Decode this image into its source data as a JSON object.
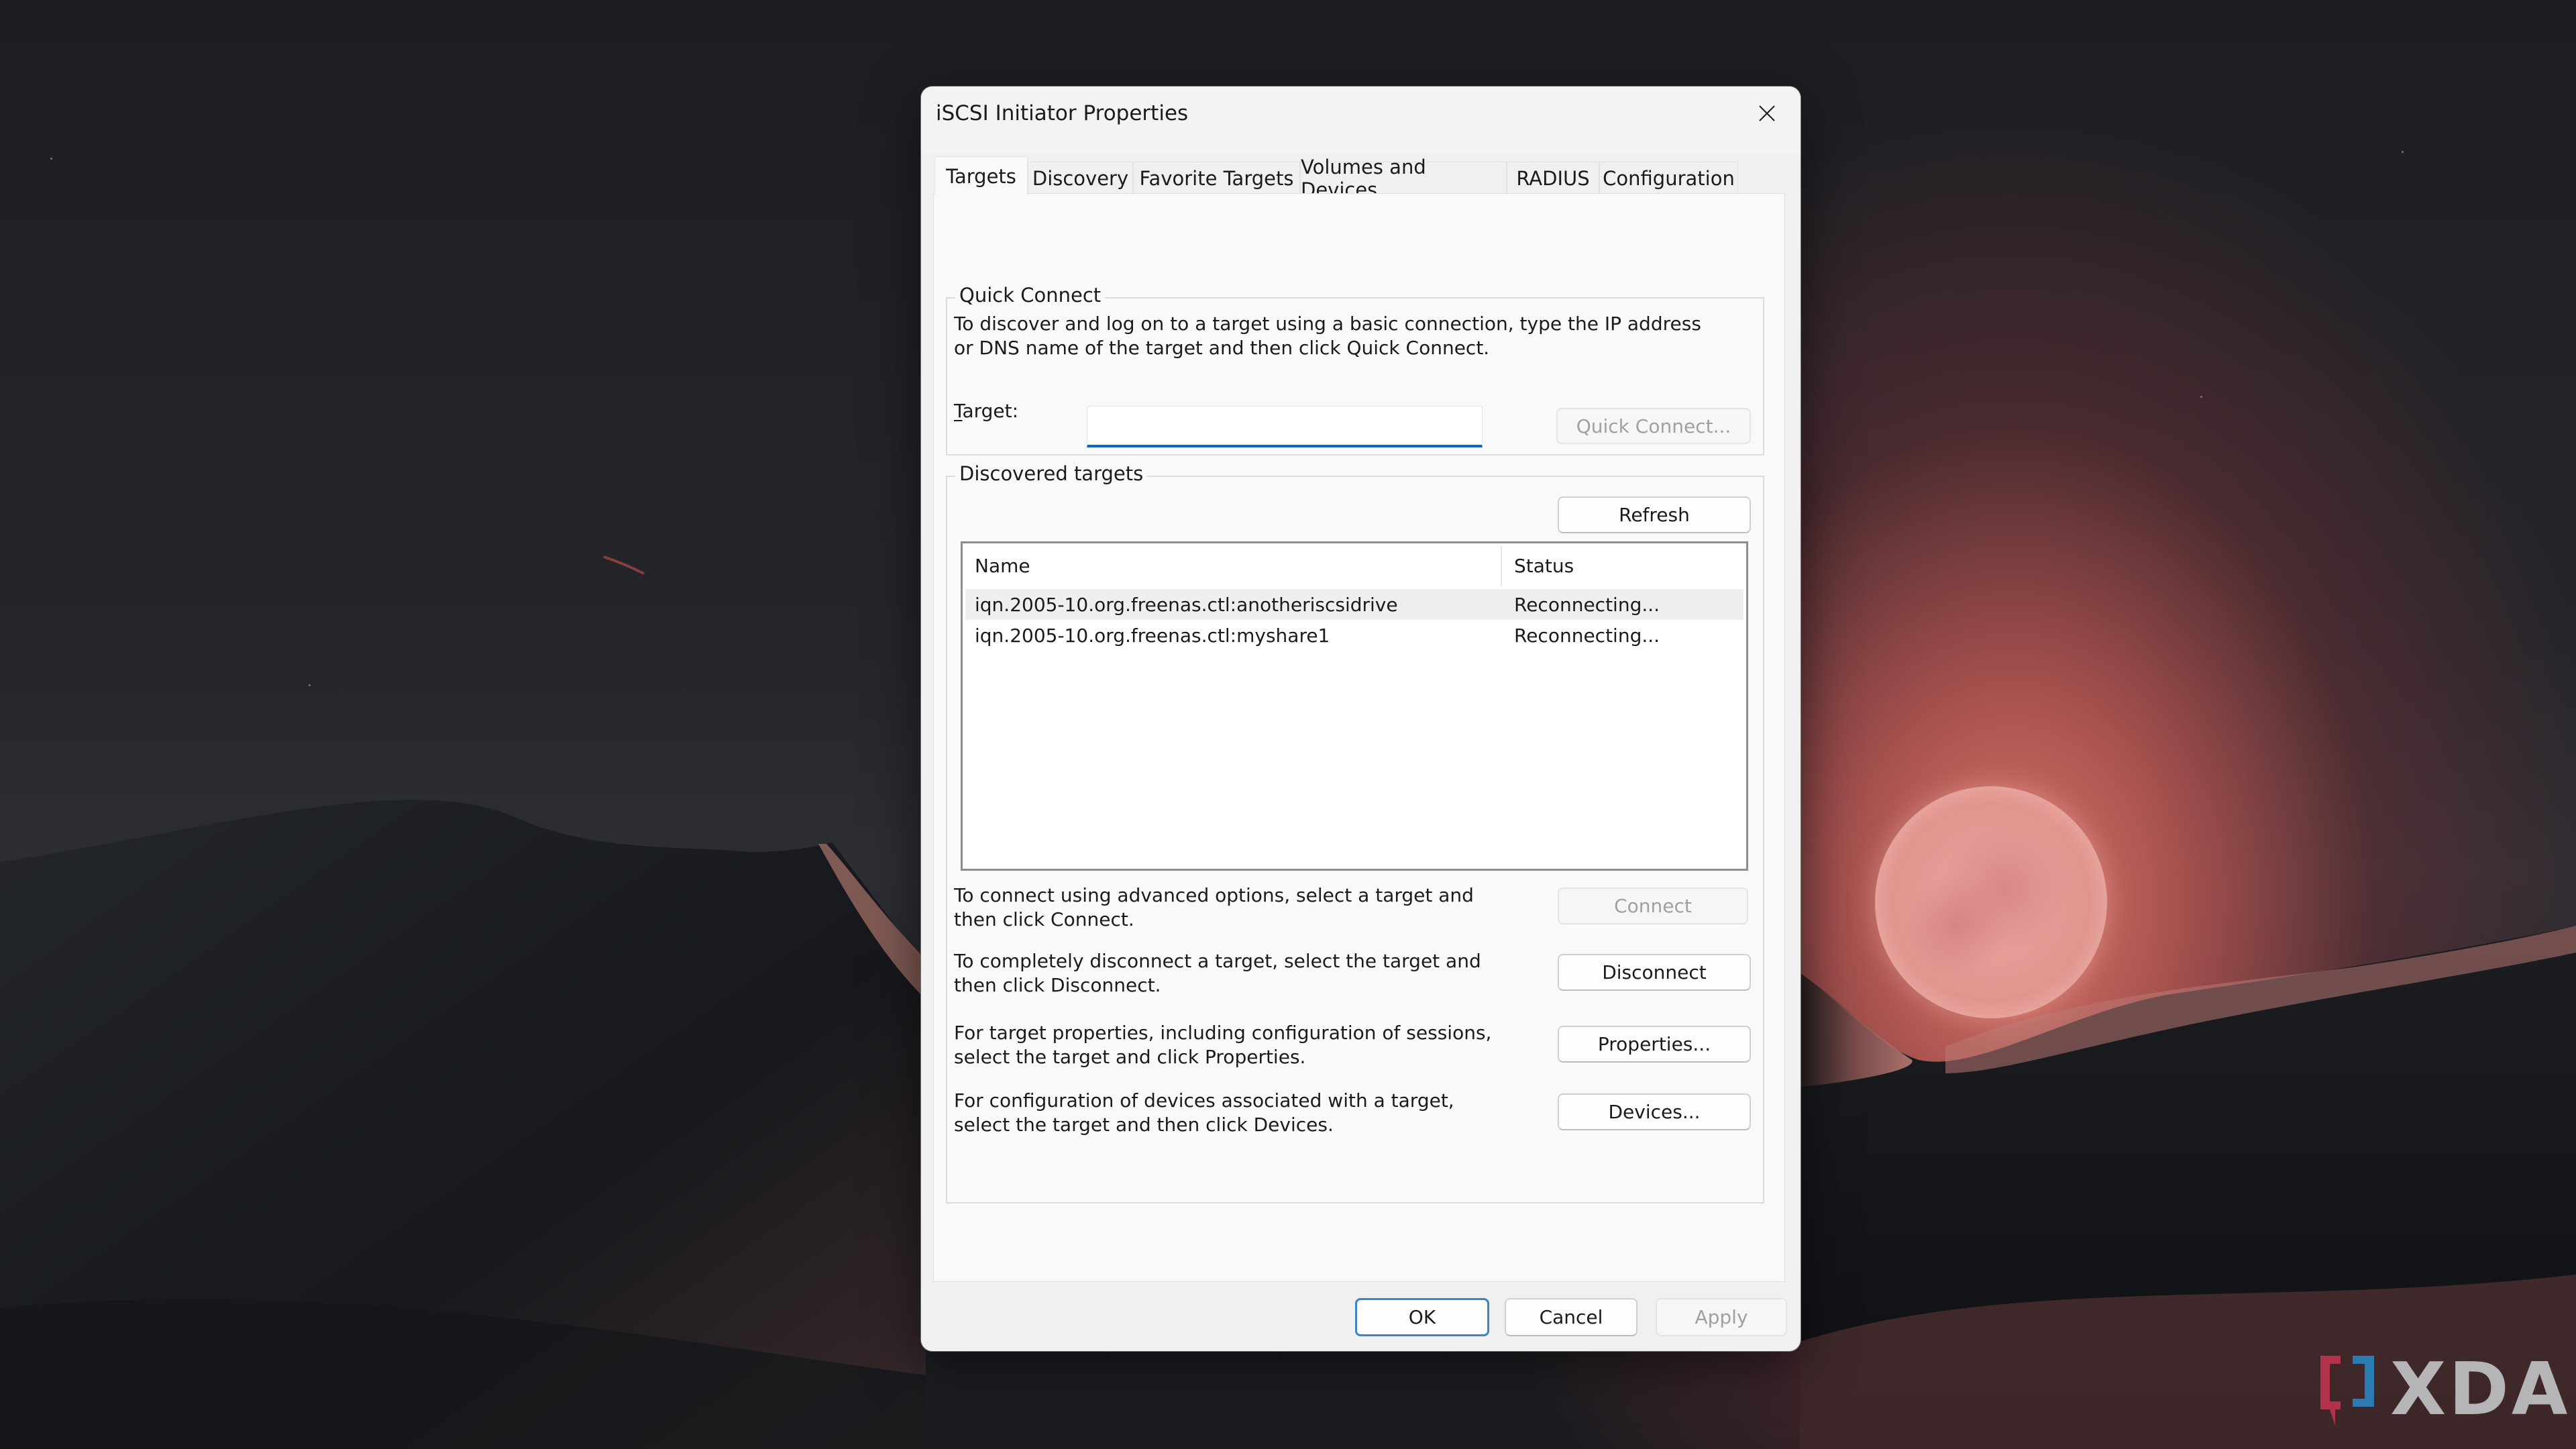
{
  "dialog": {
    "title": "iSCSI Initiator Properties",
    "close_icon": "close-icon"
  },
  "tabs": [
    {
      "label": "Targets",
      "active": true
    },
    {
      "label": "Discovery",
      "active": false
    },
    {
      "label": "Favorite Targets",
      "active": false
    },
    {
      "label": "Volumes and Devices",
      "active": false
    },
    {
      "label": "RADIUS",
      "active": false
    },
    {
      "label": "Configuration",
      "active": false
    }
  ],
  "quick_connect": {
    "group_label": "Quick Connect",
    "description": "To discover and log on to a target using a basic connection, type the IP address or DNS name of the target and then click Quick Connect.",
    "target_label": "Target:",
    "target_label_mnemonic": "T",
    "target_value": "",
    "target_placeholder": "",
    "button_label": "Quick Connect...",
    "button_enabled": false
  },
  "discovered_targets": {
    "group_label": "Discovered targets",
    "refresh_label": "Refresh",
    "columns": [
      "Name",
      "Status"
    ],
    "rows": [
      {
        "name": "iqn.2005-10.org.freenas.ctl:anotheriscsidrive",
        "status": "Reconnecting...",
        "highlighted": true
      },
      {
        "name": "iqn.2005-10.org.freenas.ctl:myshare1",
        "status": "Reconnecting...",
        "highlighted": false
      }
    ],
    "actions": [
      {
        "text": "To connect using advanced options, select a target and then click Connect.",
        "button": "Connect",
        "enabled": false
      },
      {
        "text": "To completely disconnect a target, select the target and then click Disconnect.",
        "button": "Disconnect",
        "enabled": true
      },
      {
        "text": "For target properties, including configuration of sessions, select the target and click Properties.",
        "button": "Properties...",
        "enabled": true
      },
      {
        "text": "For configuration of devices associated with a target, select the target and then click Devices.",
        "button": "Devices...",
        "enabled": true
      }
    ]
  },
  "footer": {
    "ok_label": "OK",
    "cancel_label": "Cancel",
    "apply_label": "Apply",
    "apply_enabled": false
  },
  "watermark": {
    "text": "XDA",
    "bracket_left_color": "#c0344f",
    "bracket_right_color": "#2a84c0"
  },
  "colors": {
    "accent": "#0f66c2",
    "default_button_border": "#3c83c8",
    "disabled_text": "#a0a0a0"
  }
}
